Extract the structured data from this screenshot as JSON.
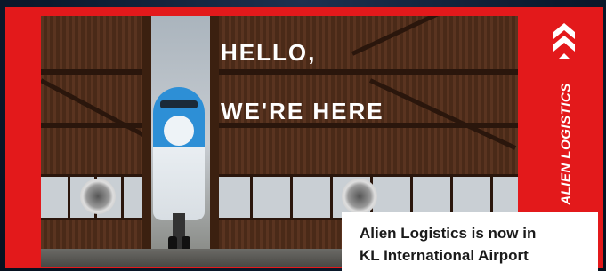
{
  "headline": {
    "line1": "HELLO,",
    "line2": "WE'RE HERE"
  },
  "announcement": {
    "line1": "Alien Logistics is now in",
    "line2": "KL International Airport"
  },
  "brand": {
    "name": "ALIEN LOGISTICS",
    "logo_icon": "chevron-arrows-logo",
    "accent_color": "#e3191b"
  }
}
